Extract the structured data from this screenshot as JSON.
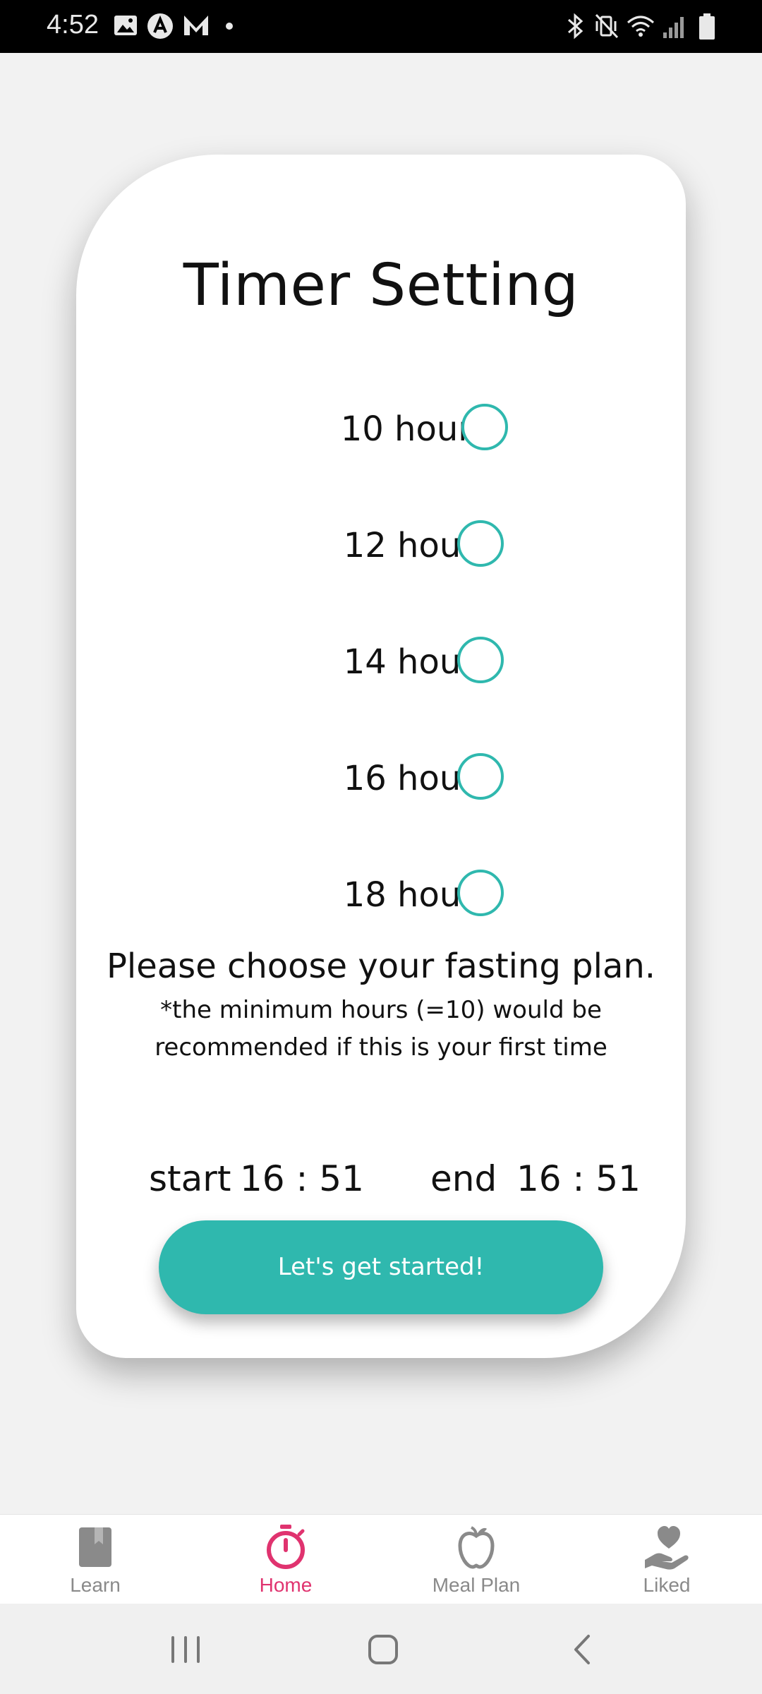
{
  "status_bar": {
    "time": "4:52",
    "left_icons": [
      "image-icon",
      "a-badge-icon",
      "m-logo-icon",
      "dot-icon"
    ],
    "right_icons": [
      "bluetooth-icon",
      "vibrate-mute-icon",
      "wifi-icon",
      "signal-icon",
      "battery-icon"
    ]
  },
  "card": {
    "title": "Timer Setting",
    "options": [
      {
        "label": "10 hours",
        "selected": false
      },
      {
        "label": "12 hours",
        "selected": false
      },
      {
        "label": "14 hours",
        "selected": false
      },
      {
        "label": "16 hours",
        "selected": false
      },
      {
        "label": "18 hours",
        "selected": false
      }
    ],
    "prompt": "Please choose your fasting plan.",
    "note_line1": "*the minimum hours (=10) would be",
    "note_line2": "recommended if this is your first time",
    "start_label": "start",
    "start_time": "16 : 51",
    "end_label": "end",
    "end_time": "16 : 51",
    "button_label": "Let's get started!"
  },
  "bottom_nav": {
    "items": [
      {
        "label": "Learn",
        "icon": "bookmark-icon",
        "active": false
      },
      {
        "label": "Home",
        "icon": "stopwatch-icon",
        "active": true
      },
      {
        "label": "Meal Plan",
        "icon": "apple-icon",
        "active": false
      },
      {
        "label": "Liked",
        "icon": "heart-hand-icon",
        "active": false
      }
    ]
  },
  "colors": {
    "accent": "#2fb8ae",
    "active_nav": "#e0336f",
    "inactive_nav": "#8a8a8a"
  }
}
